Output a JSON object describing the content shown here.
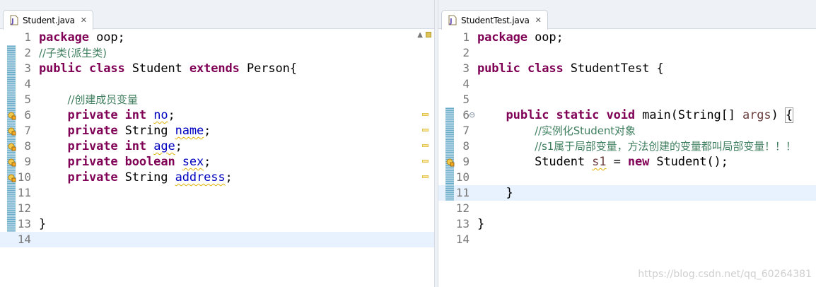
{
  "left_editor": {
    "tab_title": "Student.java",
    "tab_close": "✕",
    "lines": [
      {
        "no": "1",
        "tokens": [
          {
            "k": "kw",
            "t": "package"
          },
          {
            "t": " oop;"
          }
        ]
      },
      {
        "no": "2",
        "tokens": [
          {
            "k": "cm",
            "t": "//子类(派生类)"
          }
        ]
      },
      {
        "no": "3",
        "tokens": [
          {
            "k": "kw",
            "t": "public"
          },
          {
            "t": " "
          },
          {
            "k": "kw",
            "t": "class"
          },
          {
            "t": " Student "
          },
          {
            "k": "kw",
            "t": "extends"
          },
          {
            "t": " Person{"
          }
        ]
      },
      {
        "no": "4",
        "tokens": []
      },
      {
        "no": "5",
        "tokens": [
          {
            "t": "    "
          },
          {
            "k": "cm",
            "t": "//创建成员变量"
          }
        ]
      },
      {
        "no": "6",
        "tokens": [
          {
            "t": "    "
          },
          {
            "k": "kw",
            "t": "private"
          },
          {
            "t": " "
          },
          {
            "k": "kw",
            "t": "int"
          },
          {
            "t": " "
          },
          {
            "k": "fld",
            "t": "no"
          },
          {
            "t": ";"
          }
        ]
      },
      {
        "no": "7",
        "tokens": [
          {
            "t": "    "
          },
          {
            "k": "kw",
            "t": "private"
          },
          {
            "t": " String "
          },
          {
            "k": "fld",
            "t": "name"
          },
          {
            "t": ";"
          }
        ]
      },
      {
        "no": "8",
        "tokens": [
          {
            "t": "    "
          },
          {
            "k": "kw",
            "t": "private"
          },
          {
            "t": " "
          },
          {
            "k": "kw",
            "t": "int"
          },
          {
            "t": " "
          },
          {
            "k": "fld",
            "t": "age"
          },
          {
            "t": ";"
          }
        ]
      },
      {
        "no": "9",
        "tokens": [
          {
            "t": "    "
          },
          {
            "k": "kw",
            "t": "private"
          },
          {
            "t": " "
          },
          {
            "k": "kw",
            "t": "boolean"
          },
          {
            "t": " "
          },
          {
            "k": "fld",
            "t": "sex"
          },
          {
            "t": ";"
          }
        ]
      },
      {
        "no": "10",
        "tokens": [
          {
            "t": "    "
          },
          {
            "k": "kw",
            "t": "private"
          },
          {
            "t": " String "
          },
          {
            "k": "fld",
            "t": "address"
          },
          {
            "t": ";"
          }
        ]
      },
      {
        "no": "11",
        "tokens": []
      },
      {
        "no": "12",
        "tokens": []
      },
      {
        "no": "13",
        "tokens": [
          {
            "t": "}"
          }
        ]
      },
      {
        "no": "14",
        "tokens": []
      }
    ]
  },
  "right_editor": {
    "tab_title": "StudentTest.java",
    "tab_close": "✕",
    "lines": [
      {
        "no": "1",
        "tokens": [
          {
            "k": "kw",
            "t": "package"
          },
          {
            "t": " oop;"
          }
        ]
      },
      {
        "no": "2",
        "tokens": []
      },
      {
        "no": "3",
        "tokens": [
          {
            "k": "kw",
            "t": "public"
          },
          {
            "t": " "
          },
          {
            "k": "kw",
            "t": "class"
          },
          {
            "t": " StudentTest {"
          }
        ]
      },
      {
        "no": "4",
        "tokens": []
      },
      {
        "no": "5",
        "tokens": []
      },
      {
        "no": "6",
        "tokens": [
          {
            "t": "    "
          },
          {
            "k": "kw",
            "t": "public"
          },
          {
            "t": " "
          },
          {
            "k": "kw",
            "t": "static"
          },
          {
            "t": " "
          },
          {
            "k": "kw",
            "t": "void"
          },
          {
            "t": " main(String[] "
          },
          {
            "k": "param",
            "t": "args"
          },
          {
            "t": ") "
          },
          {
            "k": "bracket",
            "t": "{"
          }
        ]
      },
      {
        "no": "7",
        "tokens": [
          {
            "t": "        "
          },
          {
            "k": "cmm",
            "t": "//实例化Student对象"
          }
        ]
      },
      {
        "no": "8",
        "tokens": [
          {
            "t": "        "
          },
          {
            "k": "cmm",
            "t": "//s1属于局部变量，方法创建的变量都叫局部变量！！！"
          }
        ]
      },
      {
        "no": "9",
        "tokens": [
          {
            "t": "        Student "
          },
          {
            "k": "lvar",
            "t": "s1"
          },
          {
            "t": " = "
          },
          {
            "k": "kw",
            "t": "new"
          },
          {
            "t": " Student();"
          }
        ]
      },
      {
        "no": "10",
        "tokens": []
      },
      {
        "no": "11",
        "tokens": [
          {
            "t": "    }"
          }
        ]
      },
      {
        "no": "12",
        "tokens": []
      },
      {
        "no": "13",
        "tokens": [
          {
            "t": "}"
          }
        ]
      },
      {
        "no": "14",
        "tokens": []
      }
    ]
  },
  "watermark": "https://blog.csdn.net/qq_60264381",
  "colors": {
    "keyword": "#7f0055",
    "comment": "#3f7f5f",
    "field": "#0000c0",
    "local_var": "#6a3e3e",
    "current_line": "#e8f2fe"
  }
}
